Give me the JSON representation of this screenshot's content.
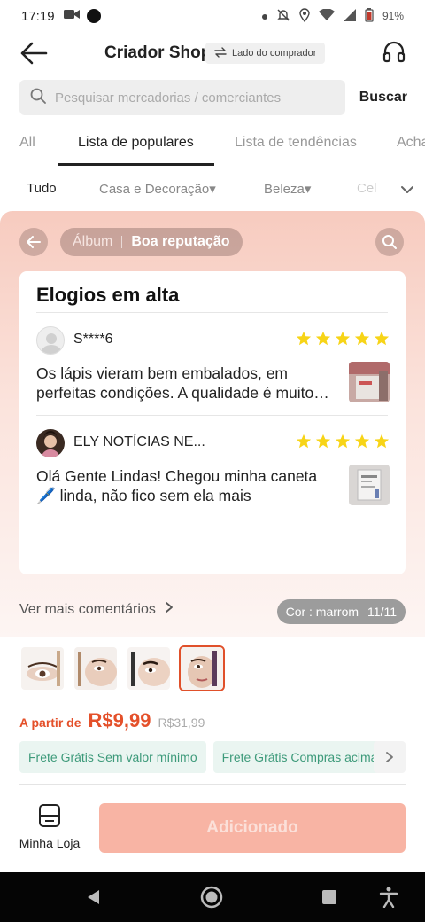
{
  "status_bar": {
    "time": "17:19",
    "battery": "91%"
  },
  "header": {
    "title": "Criador Shop",
    "buyer_mode_label": "Lado do comprador"
  },
  "search": {
    "placeholder": "Pesquisar mercadorias / comerciantes",
    "button_label": "Buscar"
  },
  "tabs": [
    {
      "label": "All",
      "active": false
    },
    {
      "label": "Lista de populares",
      "active": true
    },
    {
      "label": "Lista de tendências",
      "active": false
    },
    {
      "label": "Acha",
      "active": false
    }
  ],
  "categories": [
    {
      "label": "Tudo",
      "active": true
    },
    {
      "label": "Casa e Decoração▾",
      "active": false
    },
    {
      "label": "Beleza▾",
      "active": false
    },
    {
      "label": "Cel",
      "active": false
    }
  ],
  "panel": {
    "album_label": "Álbum",
    "reputation_label": "Boa reputação",
    "card_title": "Elogios em alta",
    "reviews": [
      {
        "name": "S****6",
        "stars": 5,
        "text": "Os lápis vieram bem embalados, em perfeitas condições. A qualidade é muito boa"
      },
      {
        "name": "ELY  NOTÍCIAS NE...",
        "stars": 5,
        "text": "Olá Gente Lindas! Chegou minha caneta 🖊️ linda, não  fico sem ela mais"
      }
    ],
    "see_more_label": "Ver mais comentários",
    "color_label": "Cor : marrom",
    "color_index": "11/11"
  },
  "thumbnails": {
    "count": 4,
    "selected_index": 3
  },
  "price": {
    "prefix": "A partir de",
    "current": "R$9,99",
    "original": "R$31,99"
  },
  "shipping_tags": [
    "Frete Grátis Sem valor mínimo",
    "Frete Grátis Compras acima"
  ],
  "bottom": {
    "shop_label": "Minha Loja",
    "add_button_label": "Adicionado"
  },
  "colors": {
    "accent": "#e4502a",
    "star": "#f7d417",
    "shipping_text": "#3d9a7a",
    "add_button_bg": "#f8b4a4"
  }
}
